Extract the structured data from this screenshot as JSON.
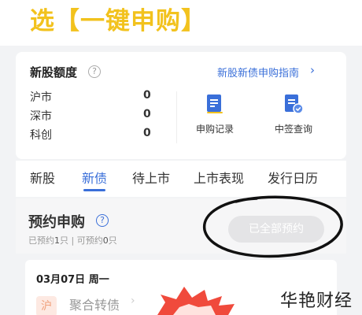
{
  "banner": {
    "title": "选【一键申购】"
  },
  "quota": {
    "title": "新股额度",
    "help_icon": "question-circle-icon",
    "guide_link": "新股新债申购指南",
    "guide_arrow": "›",
    "markets": [
      {
        "label": "沪市",
        "value": "0"
      },
      {
        "label": "深市",
        "value": "0"
      },
      {
        "label": "科创",
        "value": "0"
      }
    ],
    "actions": [
      {
        "label": "申购记录",
        "icon": "document-list-icon"
      },
      {
        "label": "中签查询",
        "icon": "document-check-icon"
      }
    ]
  },
  "tabs": [
    {
      "label": "新股",
      "active": false
    },
    {
      "label": "新债",
      "active": true
    },
    {
      "label": "待上市",
      "active": false
    },
    {
      "label": "上市表现",
      "active": false
    },
    {
      "label": "发行日历",
      "active": false
    }
  ],
  "reserve": {
    "title": "预约申购",
    "reserved_prefix": "已预约",
    "reserved_count": "1",
    "reserved_unit": "只",
    "separator": " | ",
    "available_prefix": "可预约",
    "available_count": "0",
    "available_unit": "只",
    "button_label": "已全部预约"
  },
  "listing": {
    "date": "03月07日 周一",
    "items": [
      {
        "badge": "沪",
        "name": "聚合转债"
      }
    ]
  },
  "watermark": "华艳财经",
  "colors": {
    "accent": "#3a6fd9",
    "banner_yellow": "#f2c21d",
    "badge_bg": "#fde9e2",
    "burst_red": "#f04a3c"
  }
}
